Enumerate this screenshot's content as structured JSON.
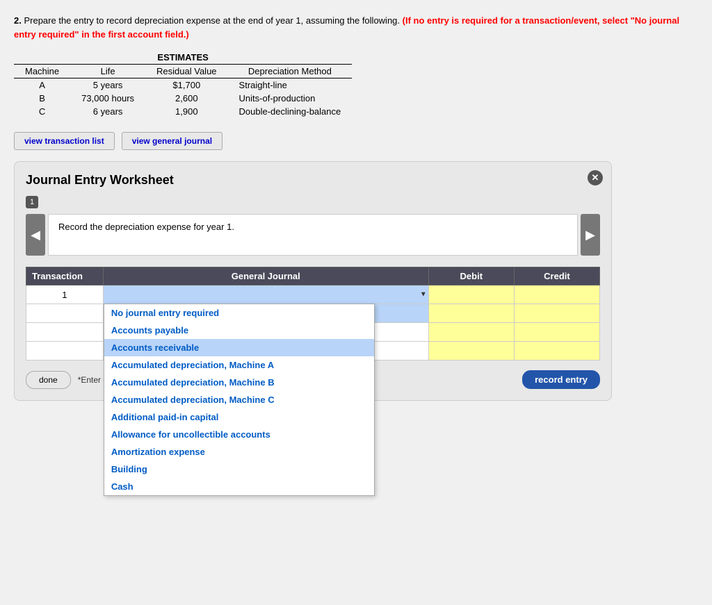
{
  "problem": {
    "number": "2.",
    "text": "Prepare the entry to record depreciation expense at the end of year 1, assuming the following.",
    "warning": "(If no entry is required for a transaction/event, select \"No journal entry required\" in the first account field.)"
  },
  "estimates_table": {
    "header": "ESTIMATES",
    "columns": [
      "Machine",
      "Life",
      "Residual Value",
      "Depreciation Method"
    ],
    "rows": [
      {
        "machine": "A",
        "life": "5 years",
        "residual": "$1,700",
        "method": "Straight-line"
      },
      {
        "machine": "B",
        "life": "73,000 hours",
        "residual": "2,600",
        "method": "Units-of-production"
      },
      {
        "machine": "C",
        "life": "6 years",
        "residual": "1,900",
        "method": "Double-declining-balance"
      }
    ]
  },
  "toolbar": {
    "view_transaction": "view transaction list",
    "view_journal": "view general journal"
  },
  "worksheet": {
    "title": "Journal Entry Worksheet",
    "step": "1",
    "description": "Record the depreciation expense for year 1.",
    "close_label": "X",
    "table": {
      "headers": [
        "Transaction",
        "General Journal",
        "Debit",
        "Credit"
      ],
      "row_number": "1"
    },
    "hint": "*Enter debits before credits",
    "done_label": "done",
    "record_label": "record entry"
  },
  "dropdown": {
    "items": [
      {
        "label": "No journal entry required",
        "id": "no-entry"
      },
      {
        "label": "Accounts payable",
        "id": "accounts-payable"
      },
      {
        "label": "Accounts receivable",
        "id": "accounts-receivable"
      },
      {
        "label": "Accumulated depreciation, Machine A",
        "id": "accum-dep-a"
      },
      {
        "label": "Accumulated depreciation, Machine B",
        "id": "accum-dep-b"
      },
      {
        "label": "Accumulated depreciation, Machine C",
        "id": "accum-dep-c"
      },
      {
        "label": "Additional paid-in capital",
        "id": "additional-paid"
      },
      {
        "label": "Allowance for uncollectible accounts",
        "id": "allowance"
      },
      {
        "label": "Amortization expense",
        "id": "amortization"
      },
      {
        "label": "Building",
        "id": "building"
      },
      {
        "label": "Cash",
        "id": "cash"
      }
    ]
  }
}
